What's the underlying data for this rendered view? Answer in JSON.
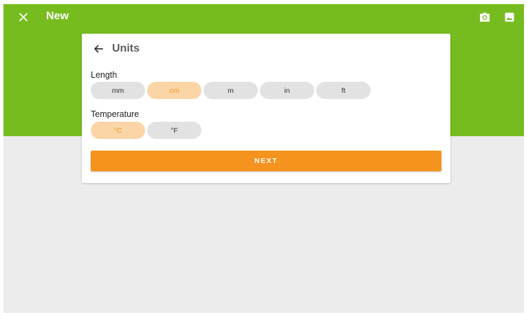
{
  "colors": {
    "appbar": "#77bc1f",
    "accent": "#f6921e",
    "chip_selected_bg": "#fbd5a6",
    "chip_bg": "#e2e2e2",
    "background": "#ececec"
  },
  "appbar": {
    "title": "New",
    "icons": [
      "close-icon",
      "camera-icon",
      "image-icon"
    ]
  },
  "card": {
    "title": "Units",
    "back_icon": "arrow-back-icon",
    "length": {
      "label": "Length",
      "options": [
        "mm",
        "cm",
        "m",
        "in",
        "ft"
      ],
      "selected": "cm"
    },
    "temperature": {
      "label": "Temperature",
      "options": [
        "°C",
        "°F"
      ],
      "selected": "°C"
    },
    "next_label": "NEXT"
  }
}
